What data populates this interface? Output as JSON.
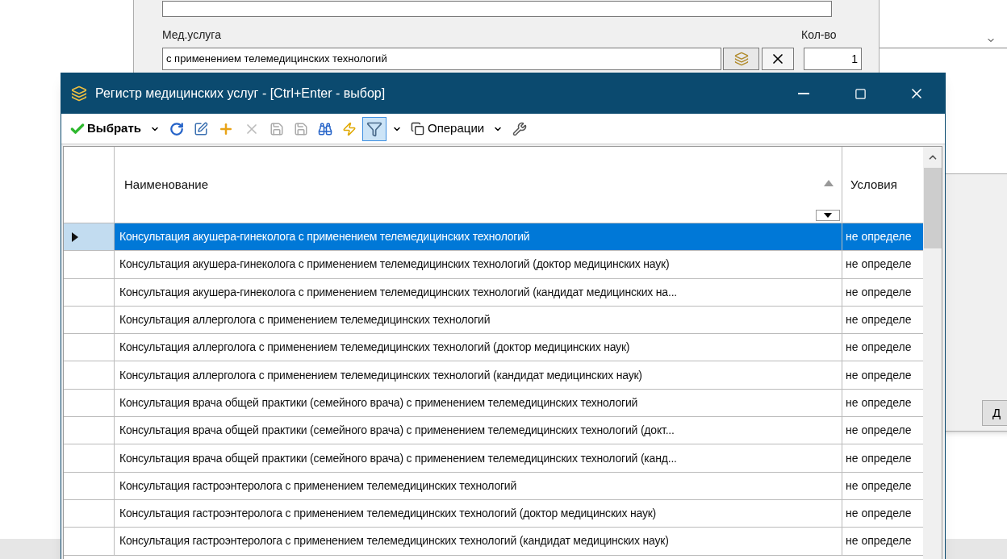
{
  "background_dialog": {
    "service_label": "Мед.услуга",
    "service_value": "с применением телемедицинских технологий",
    "quantity_label": "Кол-во",
    "quantity_value": "1"
  },
  "side_dialog": {
    "button_label": "Д"
  },
  "window": {
    "title": "Регистр медицинских услуг - [Ctrl+Enter - выбор]"
  },
  "toolbar": {
    "select_button": "Выбрать",
    "operations_button": "Операции",
    "filter_active": true
  },
  "table": {
    "columns": [
      {
        "label": "Наименование",
        "sorted": true
      },
      {
        "label": "Условия"
      }
    ],
    "rows": [
      {
        "name": "Консультация акушера-гинеколога с применением телемедицинских технологий",
        "conditions": "не определе",
        "selected": true
      },
      {
        "name": "Консультация акушера-гинеколога с применением телемедицинских технологий (доктор медицинских наук)",
        "conditions": "не определе",
        "selected": false
      },
      {
        "name": "Консультация акушера-гинеколога с применением телемедицинских технологий (кандидат медицинских на...",
        "conditions": "не определе",
        "selected": false
      },
      {
        "name": "Консультация аллерголога с применением телемедицинских технологий",
        "conditions": "не определе",
        "selected": false
      },
      {
        "name": "Консультация аллерголога с применением телемедицинских технологий (доктор медицинских наук)",
        "conditions": "не определе",
        "selected": false
      },
      {
        "name": "Консультация аллерголога с применением телемедицинских технологий (кандидат медицинских наук)",
        "conditions": "не определе",
        "selected": false
      },
      {
        "name": "Консультация врача общей практики (семейного врача) с применением телемедицинских технологий",
        "conditions": "не определе",
        "selected": false
      },
      {
        "name": "Консультация врача общей практики (семейного врача) с применением телемедицинских технологий (докт...",
        "conditions": "не определе",
        "selected": false
      },
      {
        "name": "Консультация врача общей практики (семейного врача) с применением телемедицинских технологий (канд...",
        "conditions": "не определе",
        "selected": false
      },
      {
        "name": "Консультация гастроэнтеролога с применением телемедицинских технологий",
        "conditions": "не определе",
        "selected": false
      },
      {
        "name": "Консультация гастроэнтеролога с применением телемедицинских технологий (доктор медицинских наук)",
        "conditions": "не определе",
        "selected": false
      },
      {
        "name": "Консультация гастроэнтеролога с применением телемедицинских технологий (кандидат медицинских наук)",
        "conditions": "не определе",
        "selected": false
      }
    ]
  }
}
